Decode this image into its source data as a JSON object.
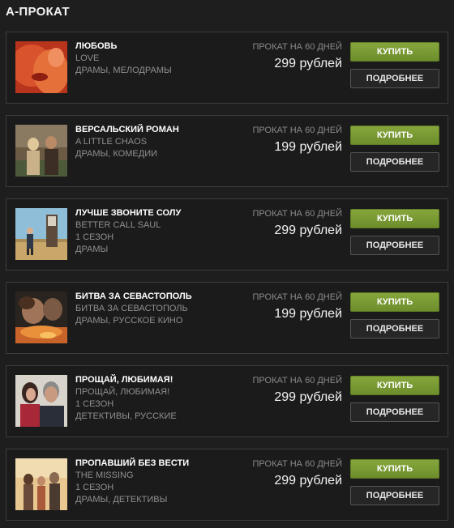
{
  "section": {
    "title": "А-ПРОКАТ"
  },
  "items": [
    {
      "title": "ЛЮБОВЬ",
      "lines": [
        "LOVE",
        "ДРАМЫ, МЕЛОДРАМЫ"
      ],
      "rental": "ПРОКАТ НА 60 ДНЕЙ",
      "price": "299 рублей",
      "buy": "КУПИТЬ",
      "more": "ПОДРОБНЕЕ"
    },
    {
      "title": "ВЕРСАЛЬСКИЙ РОМАН",
      "lines": [
        "A LITTLE CHAOS",
        "ДРАМЫ, КОМЕДИИ"
      ],
      "rental": "ПРОКАТ НА 60 ДНЕЙ",
      "price": "199 рублей",
      "buy": "КУПИТЬ",
      "more": "ПОДРОБНЕЕ"
    },
    {
      "title": "ЛУЧШЕ ЗВОНИТЕ СОЛУ",
      "lines": [
        "BETTER CALL SAUL",
        "1 СЕЗОН",
        "ДРАМЫ"
      ],
      "rental": "ПРОКАТ НА 60 ДНЕЙ",
      "price": "299 рублей",
      "buy": "КУПИТЬ",
      "more": "ПОДРОБНЕЕ"
    },
    {
      "title": "БИТВА ЗА СЕВАСТОПОЛЬ",
      "lines": [
        "БИТВА ЗА СЕВАСТОПОЛЬ",
        "ДРАМЫ, РУССКОЕ КИНО"
      ],
      "rental": "ПРОКАТ НА 60 ДНЕЙ",
      "price": "199 рублей",
      "buy": "КУПИТЬ",
      "more": "ПОДРОБНЕЕ"
    },
    {
      "title": "ПРОЩАЙ, ЛЮБИМАЯ!",
      "lines": [
        "ПРОЩАЙ, ЛЮБИМАЯ!",
        "1 СЕЗОН",
        "ДЕТЕКТИВЫ, РУССКИЕ"
      ],
      "rental": "ПРОКАТ НА 60 ДНЕЙ",
      "price": "299 рублей",
      "buy": "КУПИТЬ",
      "more": "ПОДРОБНЕЕ"
    },
    {
      "title": "ПРОПАВШИЙ БЕЗ ВЕСТИ",
      "lines": [
        "THE MISSING",
        "1 СЕЗОН",
        "ДРАМЫ, ДЕТЕКТИВЫ"
      ],
      "rental": "ПРОКАТ НА 60 ДНЕЙ",
      "price": "299 рублей",
      "buy": "КУПИТЬ",
      "more": "ПОДРОБНЕЕ"
    }
  ],
  "colors": {
    "background": "#1e1e1e",
    "card_border": "#3c3c3c",
    "buy_button": "#7a9a35",
    "secondary_text": "#8f8f8f"
  }
}
